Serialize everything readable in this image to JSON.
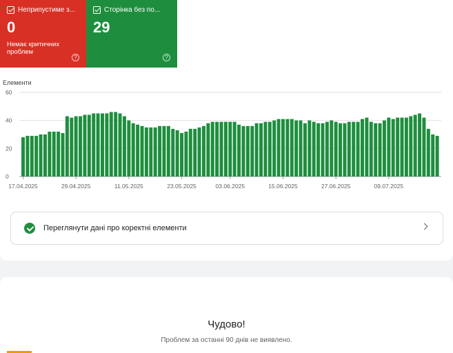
{
  "cards": {
    "red": {
      "label": "Неприпустиме з...",
      "value": "0",
      "sub": "Немає критичних проблем",
      "help": "?",
      "color": "#d93025"
    },
    "green": {
      "label": "Сторінка без по...",
      "value": "29",
      "help": "?",
      "color": "#1e8e3e"
    }
  },
  "chart_data": {
    "type": "bar",
    "ylabel": "Елементи",
    "ylim": [
      0,
      60
    ],
    "yticks": [
      0,
      20,
      40,
      60
    ],
    "xtick_labels": [
      "17.04.2025",
      "29.04.2025",
      "11.05.2025",
      "23.05.2025",
      "03.06.2025",
      "15.06.2025",
      "27.06.2025",
      "09.07.2025"
    ],
    "xtick_indices": [
      0,
      12,
      24,
      36,
      47,
      59,
      71,
      83
    ],
    "bar_color": "#1e8e3e",
    "values": [
      28,
      29,
      29,
      29,
      30,
      30,
      32,
      32,
      32,
      31,
      43,
      42,
      43,
      43,
      44,
      44,
      45,
      45,
      45,
      45,
      46,
      46,
      45,
      43,
      40,
      38,
      37,
      36,
      35,
      35,
      35,
      36,
      36,
      36,
      34,
      33,
      31,
      32,
      34,
      34,
      35,
      36,
      38,
      39,
      39,
      39,
      39,
      39,
      39,
      37,
      36,
      36,
      36,
      38,
      38,
      39,
      39,
      40,
      41,
      41,
      41,
      41,
      40,
      40,
      38,
      40,
      39,
      38,
      38,
      39,
      40,
      39,
      38,
      38,
      39,
      39,
      39,
      41,
      42,
      39,
      38,
      38,
      40,
      42,
      41,
      42,
      42,
      42,
      43,
      44,
      45,
      42,
      34,
      30,
      29
    ]
  },
  "view_link": {
    "label": "Переглянути дані про коректні елементи"
  },
  "status": {
    "title": "Чудово!",
    "message": "Проблем за останні 90 днів не виявлено."
  }
}
